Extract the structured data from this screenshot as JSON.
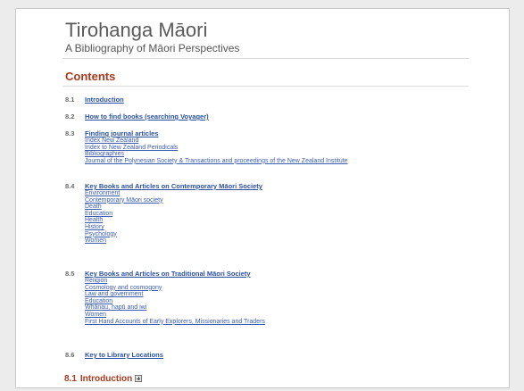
{
  "header": {
    "title": "Tirohanga Māori",
    "subtitle": "A Bibliography of Māori Perspectives"
  },
  "contents": {
    "heading": "Contents",
    "sections": [
      {
        "number": "8.1",
        "title": "Introduction",
        "links": []
      },
      {
        "number": "8.2",
        "title": "How to find books (searching Voyager)",
        "links": []
      },
      {
        "number": "8.3",
        "title": "Finding journal articles",
        "links": [
          "Index New Zealand",
          "Index to New Zealand Periodicals",
          "Bibliographies",
          "Journal of the Polynesian Society & Transactions and proceedings of the New Zealand Institute"
        ]
      },
      {
        "number": "8.4",
        "title": "Key Books and Articles on Contemporary Māori Society",
        "links": [
          "Environment",
          "Contemporary Māori society",
          "Death",
          "Education",
          "Health",
          "History",
          "Psychology",
          "Women"
        ]
      },
      {
        "number": "8.5",
        "title": "Key Books and Articles on Traditional Māori Society",
        "links": [
          "Religion",
          "Cosmology and cosmogony",
          "Law and government",
          "Education",
          "Whānau, hapū and iwi",
          "Women",
          "First Hand Accounts of Early Explorers, Missionaries and Traders"
        ]
      },
      {
        "number": "8.6",
        "title": "Key to Library Locations",
        "links": []
      }
    ]
  },
  "section_heading": {
    "number": "8.1",
    "title": "Introduction",
    "icon": "expand-icon"
  }
}
